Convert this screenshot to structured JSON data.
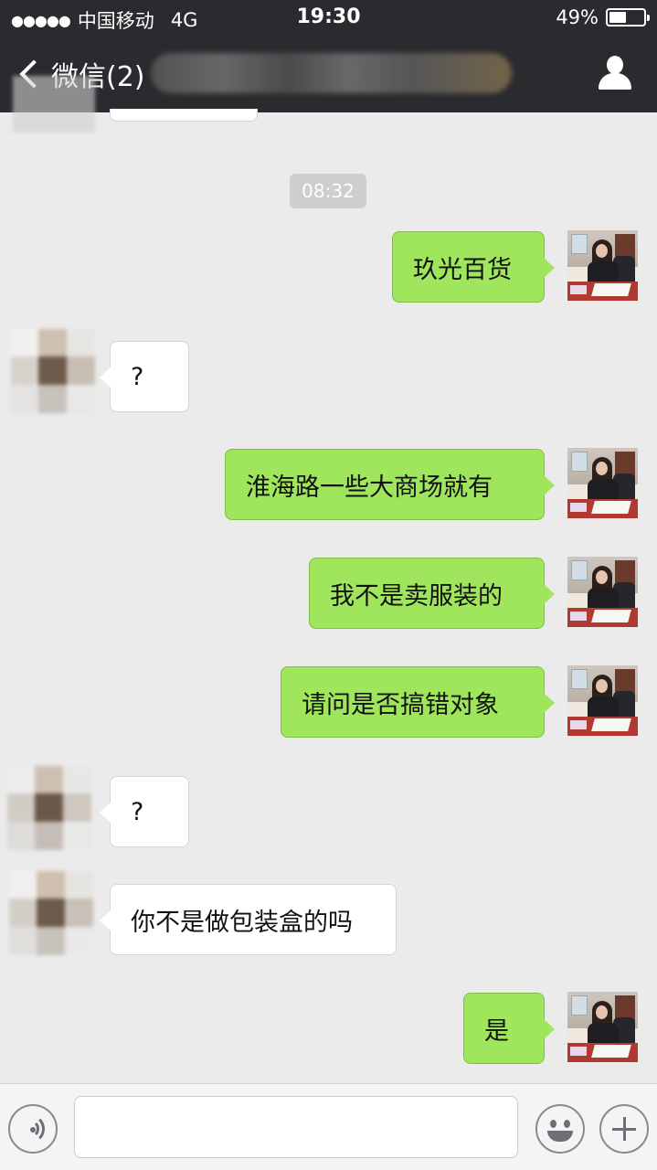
{
  "status_bar": {
    "signal_dots": "●●●●●",
    "carrier": "中国移动",
    "network": "4G",
    "time": "19:30",
    "battery_percent": "49%",
    "battery_level": 0.49
  },
  "nav": {
    "back_label": "微信(2)",
    "contact_name_blurred": true,
    "contact_icon": "person-icon"
  },
  "chat": {
    "timestamp": "08:32",
    "messages": [
      {
        "from": "me",
        "text": "玖光百货"
      },
      {
        "from": "other",
        "text": "?"
      },
      {
        "from": "me",
        "text": "淮海路一些大商场就有"
      },
      {
        "from": "me",
        "text": "我不是卖服装的"
      },
      {
        "from": "me",
        "text": "请问是否搞错对象"
      },
      {
        "from": "other",
        "text": "?"
      },
      {
        "from": "other",
        "text": "你不是做包装盒的吗"
      },
      {
        "from": "me",
        "text": "是"
      }
    ]
  },
  "input_bar": {
    "voice_icon": "voice-icon",
    "text_value": "",
    "emoji_icon": "emoji-icon",
    "more_icon": "plus-icon"
  },
  "colors": {
    "nav_bg": "#2b2b2f",
    "chat_bg": "#ebebeb",
    "sent_bubble": "#9fe65c",
    "received_bubble": "#ffffff"
  }
}
